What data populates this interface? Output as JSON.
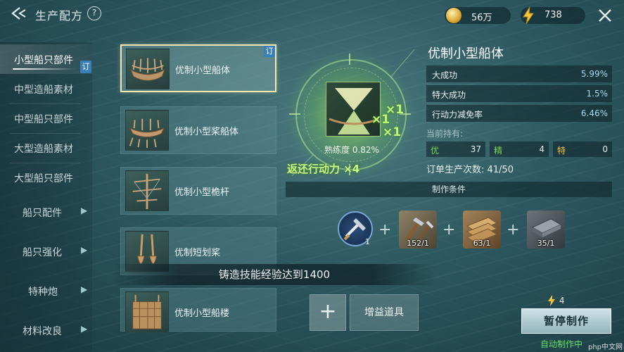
{
  "header": {
    "title": "生产配方",
    "help_label": "?",
    "gold": "56万",
    "energy": "738"
  },
  "nav": {
    "items": [
      {
        "label": "小型船只部件",
        "selected": true
      },
      {
        "label": "中型造船素材"
      },
      {
        "label": "中型船只部件"
      },
      {
        "label": "大型造船素材"
      },
      {
        "label": "大型船只部件"
      }
    ],
    "badge": "订",
    "groups": [
      {
        "label": "船只配件"
      },
      {
        "label": "船只强化"
      },
      {
        "label": "特种炮"
      },
      {
        "label": "材料改良"
      }
    ]
  },
  "recipes": [
    {
      "name": "优制小型船体",
      "selected": true,
      "tag": "订"
    },
    {
      "name": "优制小型桨船体"
    },
    {
      "name": "优制小型桅杆"
    },
    {
      "name": "优制短划桨"
    },
    {
      "name": "优制小型船楼"
    }
  ],
  "requirement": "铸造技能经验达到1400",
  "center": {
    "multipliers": [
      "×1",
      "×1",
      "×1"
    ],
    "proficiency": "熟练度 0.82%",
    "refund": "返还行动力 ×4"
  },
  "detail": {
    "title": "优制小型船体",
    "stats": [
      {
        "label": "大成功",
        "value": "5.99%"
      },
      {
        "label": "特大成功",
        "value": "1.5%"
      },
      {
        "label": "行动力减免率",
        "value": "6.46%"
      }
    ],
    "holding_label": "当前持有:",
    "holdings": [
      {
        "label": "优",
        "value": "37"
      },
      {
        "label": "精",
        "value": "4"
      },
      {
        "label": "特",
        "value": "0"
      }
    ],
    "order_count": "订单生产次数: 41/50",
    "conditions_label": "制作条件"
  },
  "materials": {
    "skill_count": "1",
    "items": [
      {
        "icon": "tools-icon",
        "count": "152/1"
      },
      {
        "icon": "wood-planks-icon",
        "count": "63/1"
      },
      {
        "icon": "metal-sheet-icon",
        "count": "35/1"
      }
    ]
  },
  "bottom": {
    "add_label": "+",
    "buff_label": "增益道具",
    "cost": "4",
    "pause_label": "暂停制作",
    "auto_status": "自动制作中",
    "watermark": "php中文网"
  },
  "colors": {
    "badge_blue": "#3a7fb7",
    "glow_green": "#c9f78a",
    "status_green": "#66e06a"
  }
}
